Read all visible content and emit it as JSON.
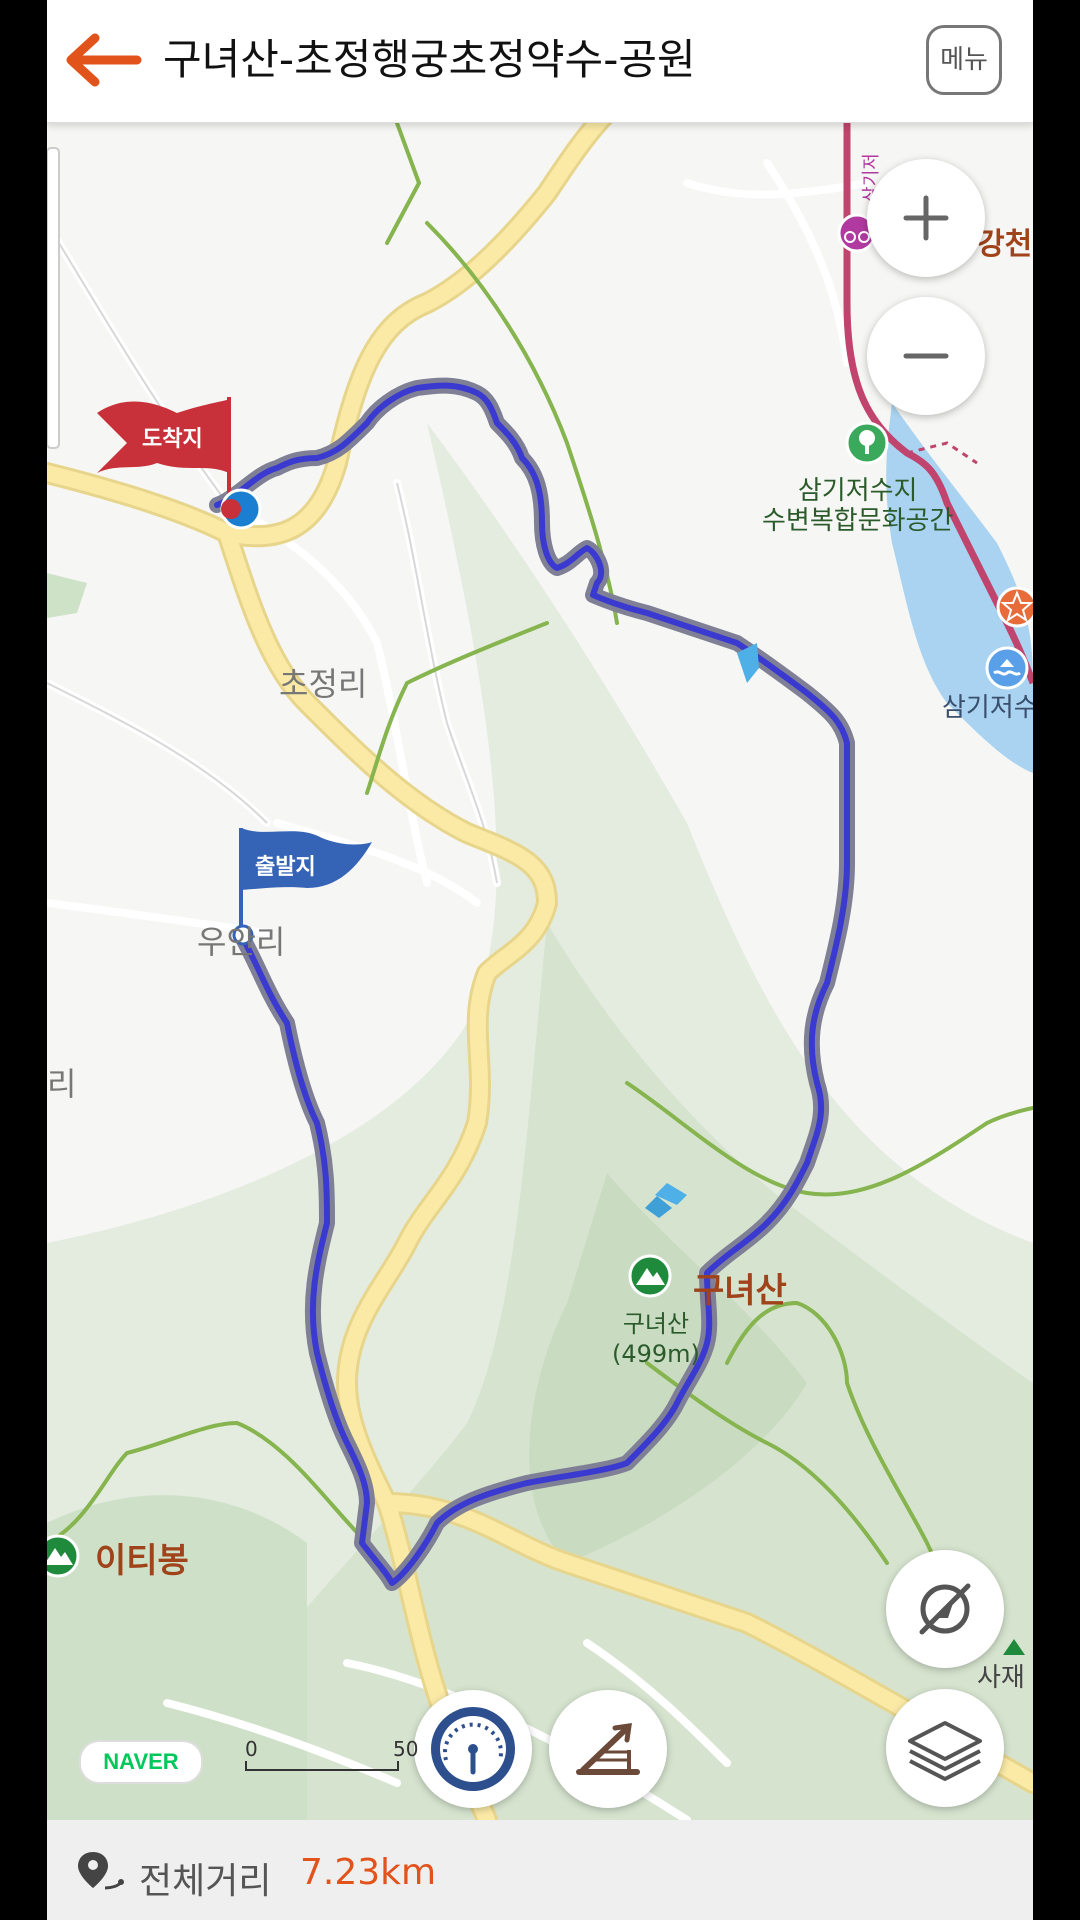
{
  "header": {
    "title": "구녀산-초정행궁초정약수-공원",
    "menu_label": "메뉴"
  },
  "map": {
    "flags": {
      "arrival": "도착지",
      "departure": "출발지"
    },
    "labels": {
      "chojeong": "초정리",
      "uan": "우안리",
      "ri_left": "리",
      "gunyeosan": "구녀산",
      "gunyeosan_peak": "구녀산",
      "gunyeosan_alt": "(499m)",
      "itibong": "이티봉",
      "samgi_reservoir_line1": "삼기저수지",
      "samgi_reservoir_line2": "수변복합문화공간",
      "samgi_reservoir_short": "삼기저수",
      "gangcheon": "강천",
      "sajae": "사재",
      "samgi_road": "삼기저"
    },
    "zoom_in": "+",
    "zoom_out": "−",
    "naver": "NAVER",
    "scale_start": "0",
    "scale_end": "50"
  },
  "footer": {
    "distance_label": "전체거리",
    "distance_value": "7.23km"
  },
  "colors": {
    "accent": "#e2531b",
    "route": "#3a3ad0",
    "arrival_flag": "#c8313a",
    "departure_flag": "#3564b6"
  },
  "icons": [
    "back-arrow-icon",
    "route-pin-icon",
    "speedometer-icon",
    "elevation-icon",
    "compass-off-icon",
    "layers-icon"
  ]
}
